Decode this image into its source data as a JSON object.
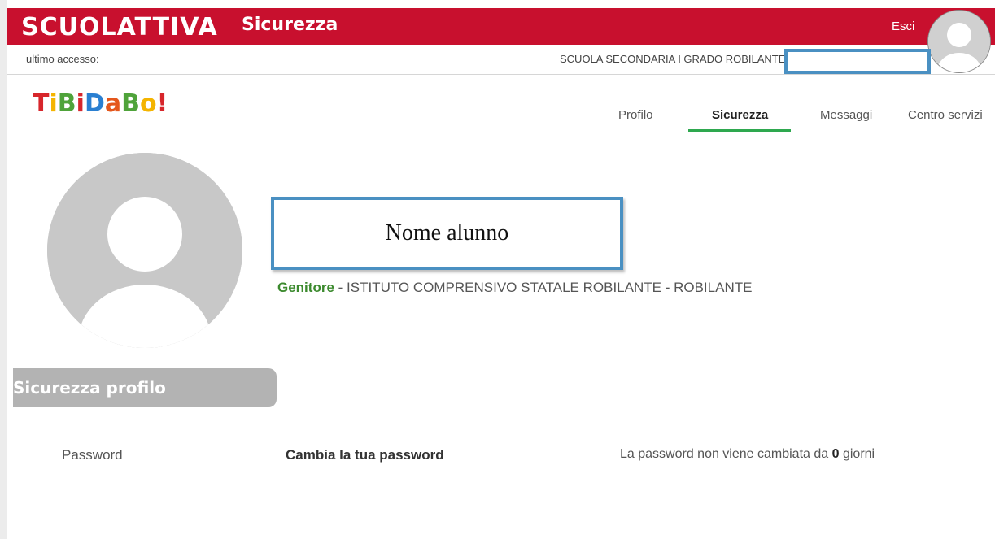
{
  "header": {
    "brand": "SCUOLATTIVA",
    "section_title": "Sicurezza",
    "logout_label": "Esci"
  },
  "infobar": {
    "last_access_label": "ultimo accesso:",
    "school_name": "SCUOLA SECONDARIA I GRADO ROBILANTE"
  },
  "logo": {
    "letters": [
      "T",
      "i",
      "B",
      "i",
      "D",
      "a",
      "B",
      "o",
      "!"
    ],
    "colors": [
      "#d7262b",
      "#f4b400",
      "#4fa33a",
      "#d7262b",
      "#2a7fd1",
      "#e4571c",
      "#4fa33a",
      "#f4b400",
      "#d7262b"
    ]
  },
  "nav": {
    "tabs": [
      {
        "label": "Profilo"
      },
      {
        "label": "Sicurezza"
      },
      {
        "label": "Messaggi"
      },
      {
        "label": "Centro servizi"
      }
    ],
    "active": "Sicurezza"
  },
  "profile": {
    "name": "Nome alunno",
    "role": "Genitore",
    "institution": " - ISTITUTO COMPRENSIVO STATALE ROBILANTE - ROBILANTE"
  },
  "security": {
    "section_title": "Sicurezza profilo",
    "password_label": "Password",
    "change_password_label": "Cambia la tua password",
    "status_prefix": "La password non viene cambiata da ",
    "status_days": "0",
    "status_suffix": " giorni"
  },
  "colors": {
    "brand_red": "#c8102e",
    "accent_green": "#2ea84f",
    "highlight_blue": "#4a90c2",
    "role_green": "#3c8a2e"
  }
}
